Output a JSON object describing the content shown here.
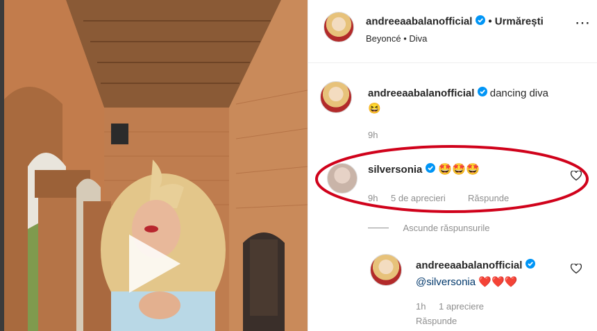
{
  "header": {
    "username": "andreeaabalanofficial",
    "follow_label": "• Urmărești",
    "subtitle": "Beyoncé • Diva",
    "more_label": "⋯"
  },
  "caption": {
    "username": "andreeaabalanofficial",
    "text": "dancing diva",
    "emoji": "😆",
    "time": "9h"
  },
  "comment": {
    "username": "silversonia",
    "emojis": "🤩🤩🤩",
    "time": "9h",
    "likes": "5 de aprecieri",
    "reply_label": "Răspunde"
  },
  "toggle_replies": "Ascunde răspunsurile",
  "reply": {
    "username": "andreeaabalanofficial",
    "mention": "@silversonia",
    "hearts": "❤️❤️❤️",
    "time": "1h",
    "likes": "1 apreciere",
    "reply_label": "Răspunde"
  },
  "colors": {
    "verified": "#0095f6",
    "annotation": "#d0021b",
    "mention": "#00376b"
  }
}
